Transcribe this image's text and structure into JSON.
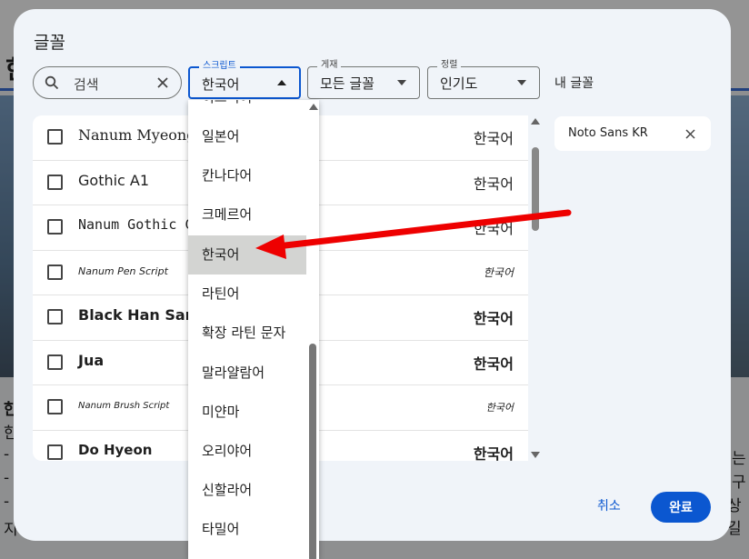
{
  "dialog": {
    "title": "글꼴",
    "search": {
      "placeholder": "검색"
    },
    "script_field": {
      "label": "스크립트",
      "value": "한국어"
    },
    "subset_field": {
      "label": "게재",
      "value": "모든 글꼴"
    },
    "sort_field": {
      "label": "정렬",
      "value": "인기도"
    },
    "my_fonts_label": "내 글꼴",
    "font_rows": [
      {
        "name": "Nanum Myeongjo",
        "sample": "한국어"
      },
      {
        "name": "Gothic A1",
        "sample": "한국어"
      },
      {
        "name": "Nanum Gothic Coding",
        "sample": "한국어"
      },
      {
        "name": "Nanum Pen Script",
        "sample": "한국어"
      },
      {
        "name": "Black Han Sans",
        "sample": "한국어"
      },
      {
        "name": "Jua",
        "sample": "한국어"
      },
      {
        "name": "Nanum Brush Script",
        "sample": "한국어"
      },
      {
        "name": "Do Hyeon",
        "sample": "한국어"
      }
    ],
    "selected_chip": "Noto Sans KR",
    "cancel_label": "취소",
    "done_label": "완료"
  },
  "script_menu": {
    "partial_top": "히브리어",
    "items": [
      "일본어",
      "칸나다어",
      "크메르어",
      "한국어",
      "라틴어",
      "확장 라틴 문자",
      "말라얄람어",
      "미얀마",
      "오리야어",
      "신할라어",
      "타밀어"
    ],
    "selected": "한국어"
  },
  "background": {
    "title": "한",
    "left_texts": [
      "한",
      "한",
      "-",
      "-",
      "-",
      "지"
    ],
    "right_texts": [
      "는",
      "구",
      "상길"
    ]
  },
  "colors": {
    "accent": "#0b57d0",
    "arrow": "#ee0000",
    "dialog_bg": "#f0f4f9"
  }
}
